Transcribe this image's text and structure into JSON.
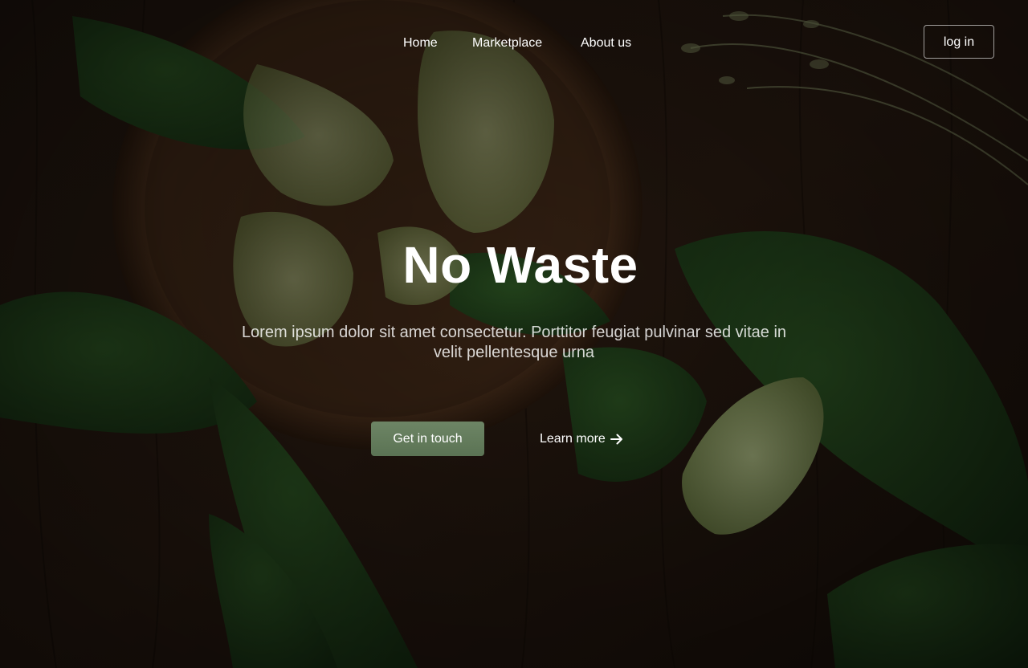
{
  "nav": {
    "items": [
      {
        "label": "Home"
      },
      {
        "label": "Marketplace"
      },
      {
        "label": "About us"
      }
    ],
    "login_label": "log in"
  },
  "hero": {
    "title": "No Waste",
    "subtitle": "Lorem ipsum dolor sit amet consectetur. Porttitor feugiat pulvinar sed vitae in velit pellentesque urna",
    "primary_cta": "Get in touch",
    "secondary_cta": "Learn more",
    "secondary_cta_icon": "arrow-right-icon",
    "background": "bok-choy-on-dark-wooden-table-photo"
  },
  "colors": {
    "primary_button": "#6d8565",
    "text": "#ffffff",
    "background_wood": "#1f140c"
  }
}
